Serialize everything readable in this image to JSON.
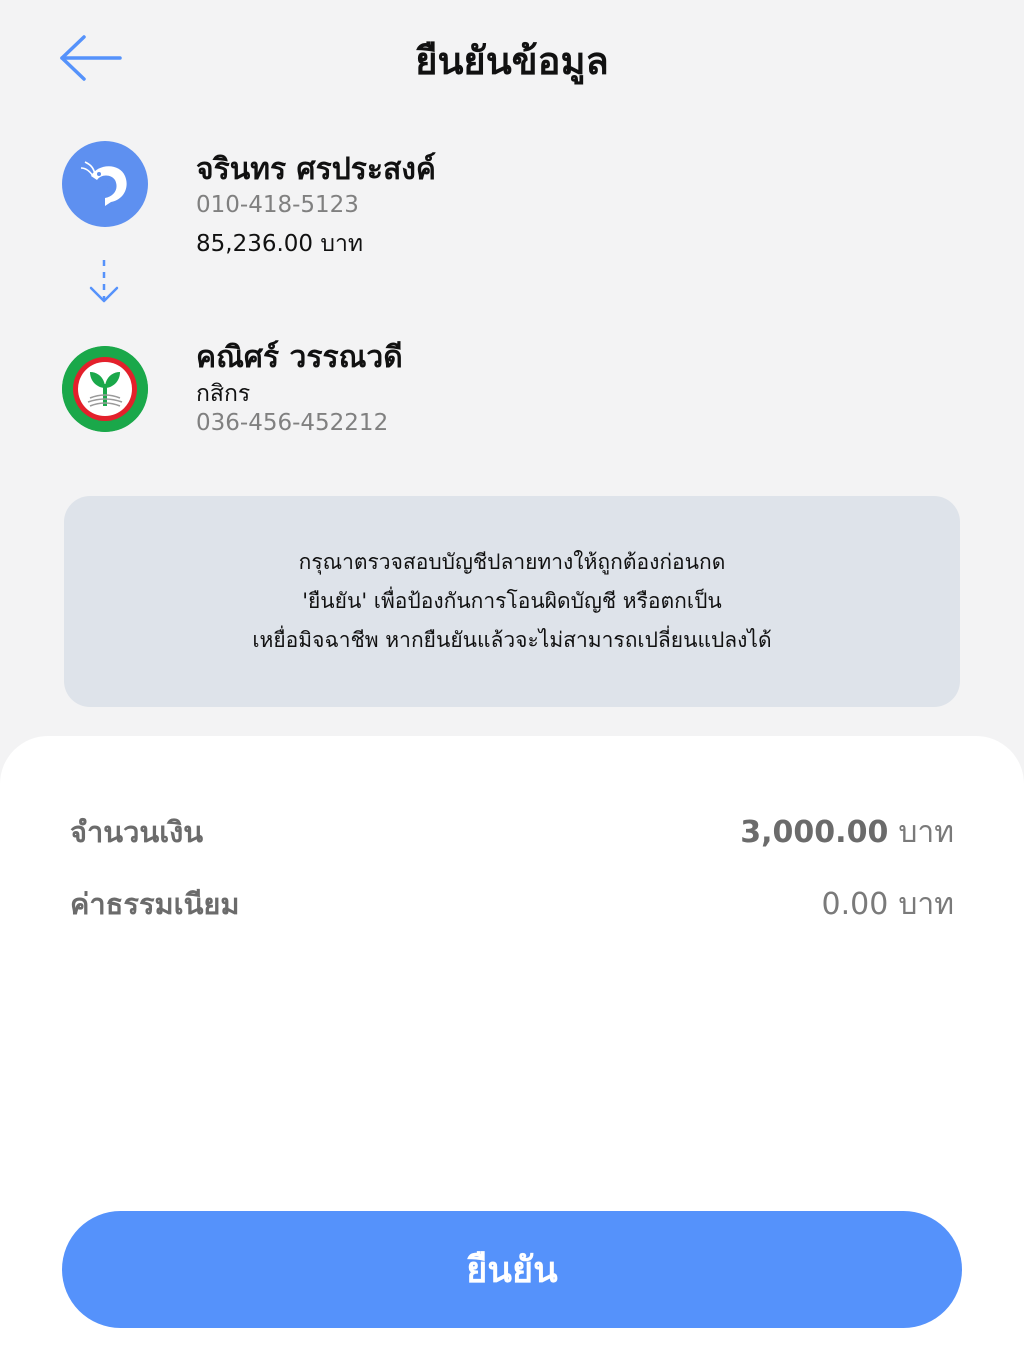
{
  "header": {
    "title": "ยืนยันข้อมูล"
  },
  "sender": {
    "name": "จรินทร ศรประสงค์",
    "account": "010-418-5123",
    "balance": "85,236.00 บาท",
    "icon": "shrimp-icon",
    "color": "#5e90f0"
  },
  "receiver": {
    "name": "คณิศร์ วรรณวดี",
    "bank": "กสิกร",
    "account": "036-456-452212",
    "icon": "kasikorn-bank-logo",
    "color": "#1aa84a"
  },
  "notice": {
    "lines": [
      "กรุณาตรวจสอบบัญชีปลายทางให้ถูกต้องก่อนกด",
      "'ยืนยัน' เพื่อป้องกันการโอนผิดบัญชี หรือตกเป็น",
      "เหยื่อมิจฉาชีพ หากยืนยันแล้วจะไม่สามารถเปลี่ยนแปลงได้"
    ]
  },
  "summary": {
    "amount_label": "จำนวนเงิน",
    "amount_value": "3,000.00",
    "amount_unit": "บาท",
    "fee_label": "ค่าธรรมเนียม",
    "fee_value": "0.00",
    "fee_unit": "บาท"
  },
  "actions": {
    "confirm_label": "ยืนยัน"
  },
  "colors": {
    "accent": "#5592fb",
    "notice_bg": "#dee3ea"
  }
}
